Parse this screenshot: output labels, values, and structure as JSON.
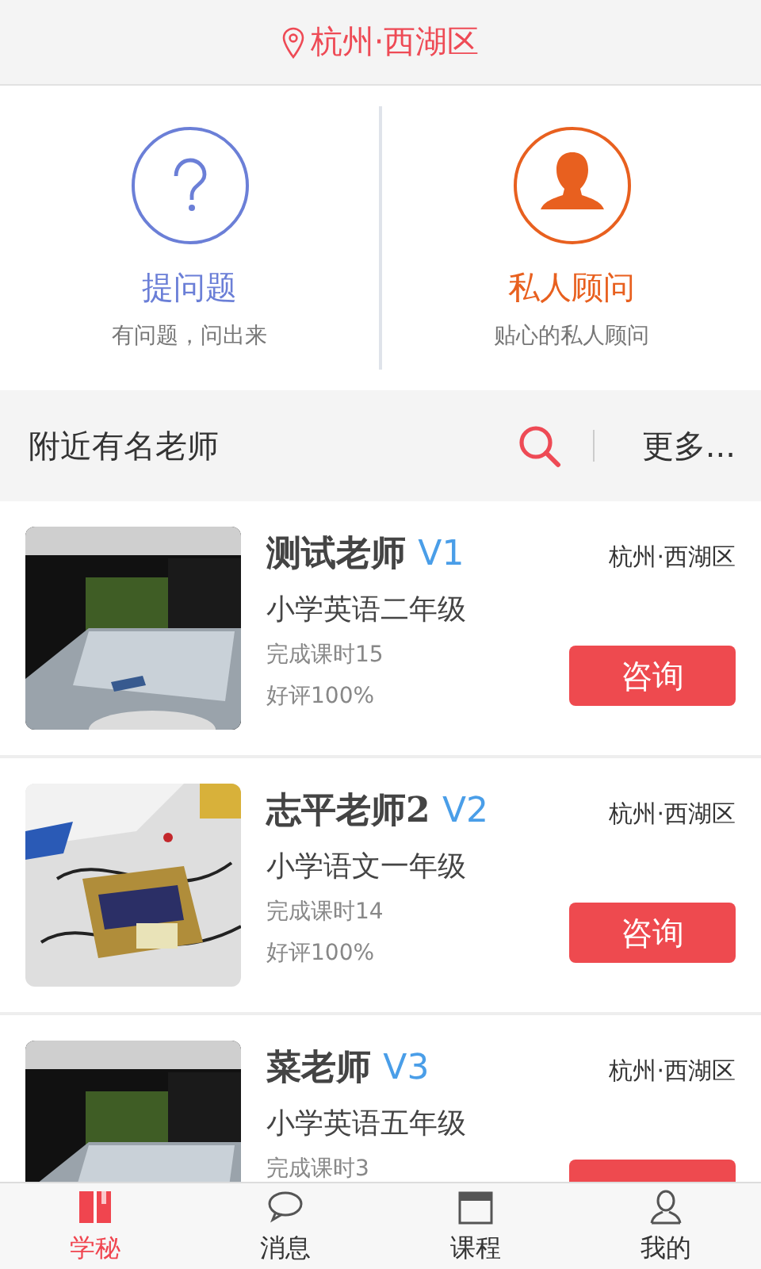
{
  "header": {
    "location": "杭州·西湖区"
  },
  "shortcuts": [
    {
      "kind": "question",
      "title": "提问题",
      "subtitle": "有问题，问出来",
      "color": "#6b7fd7"
    },
    {
      "kind": "advisor",
      "title": "私人顾问",
      "subtitle": "贴心的私人顾问",
      "color": "#e8601f"
    }
  ],
  "section": {
    "title": "附近有名老师",
    "more": "更多..."
  },
  "teachers": [
    {
      "name": "测试老师",
      "level": "V1",
      "location": "杭州·西湖区",
      "course": "小学英语二年级",
      "lessons": "完成课时15",
      "rating": "好评100%",
      "button": "咨询"
    },
    {
      "name": "志平老师2",
      "level": "V2",
      "location": "杭州·西湖区",
      "course": "小学语文一年级",
      "lessons": "完成课时14",
      "rating": "好评100%",
      "button": "咨询"
    },
    {
      "name": "菜老师",
      "level": "V3",
      "location": "杭州·西湖区",
      "course": "小学英语五年级",
      "lessons": "完成课时3"
    }
  ],
  "tabs": [
    {
      "kind": "book",
      "label": "学秘",
      "selected": true
    },
    {
      "kind": "chat",
      "label": "消息",
      "selected": false
    },
    {
      "kind": "calendar",
      "label": "课程",
      "selected": false
    },
    {
      "kind": "person",
      "label": "我的",
      "selected": false
    }
  ]
}
